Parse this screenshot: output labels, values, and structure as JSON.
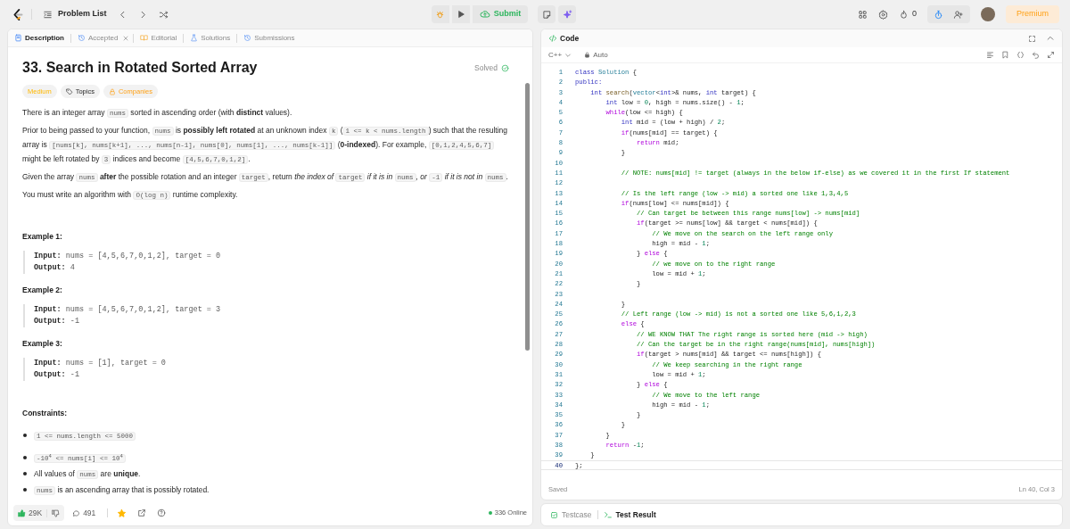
{
  "topbar": {
    "problem_list": "Problem List",
    "submit": "Submit",
    "streak": "0",
    "premium": "Premium"
  },
  "tabs": [
    {
      "kind": "description",
      "label": "Description",
      "selected": true,
      "closable": false
    },
    {
      "kind": "accepted",
      "label": "Accepted",
      "selected": false,
      "closable": true
    },
    {
      "kind": "editorial",
      "label": "Editorial",
      "selected": false,
      "closable": false
    },
    {
      "kind": "solutions",
      "label": "Solutions",
      "selected": false,
      "closable": false
    },
    {
      "kind": "submissions",
      "label": "Submissions",
      "selected": false,
      "closable": false
    }
  ],
  "problem": {
    "title": "33. Search in Rotated Sorted Array",
    "status": "Solved",
    "tags": [
      {
        "kind": "difficulty",
        "label": "Medium"
      },
      {
        "kind": "topics",
        "label": "Topics"
      },
      {
        "kind": "companies",
        "label": "Companies"
      }
    ],
    "paragraphs": [
      [
        {
          "kind": "text",
          "text": "There is an integer array "
        },
        {
          "kind": "code",
          "text": "nums"
        },
        {
          "kind": "text",
          "text": " sorted in ascending order (with **distinct** values)."
        }
      ],
      [
        {
          "kind": "text",
          "text": "Prior to being passed to your function, "
        },
        {
          "kind": "code",
          "text": "nums"
        },
        {
          "kind": "text",
          "text": " is **possibly left rotated** at an unknown index "
        },
        {
          "kind": "code",
          "text": "k"
        },
        {
          "kind": "text",
          "text": " ("
        },
        {
          "kind": "code",
          "text": "1 <= k < nums.length"
        },
        {
          "kind": "text",
          "text": ") such that the resulting array is "
        },
        {
          "kind": "code",
          "text": "[nums[k], nums[k+1], ..., nums[n-1], nums[0], nums[1], ..., nums[k-1]]"
        },
        {
          "kind": "text",
          "text": " (**0-indexed**). For example, "
        },
        {
          "kind": "code",
          "text": "[0,1,2,4,5,6,7]"
        },
        {
          "kind": "text",
          "text": " might be left rotated by "
        },
        {
          "kind": "code",
          "text": "3"
        },
        {
          "kind": "text",
          "text": " indices and become "
        },
        {
          "kind": "code",
          "text": "[4,5,6,7,0,1,2]"
        },
        {
          "kind": "text",
          "text": "."
        }
      ],
      [
        {
          "kind": "text",
          "text": "Given the array "
        },
        {
          "kind": "code",
          "text": "nums"
        },
        {
          "kind": "text",
          "text": " **after** the possible rotation and an integer "
        },
        {
          "kind": "code",
          "text": "target"
        },
        {
          "kind": "text",
          "text": ", return *the index of* "
        },
        {
          "kind": "code",
          "text": "target"
        },
        {
          "kind": "text",
          "text": " *if it is in* "
        },
        {
          "kind": "code",
          "text": "nums"
        },
        {
          "kind": "text",
          "text": "*, or* "
        },
        {
          "kind": "code",
          "text": "-1"
        },
        {
          "kind": "text",
          "text": " *if it is not in* "
        },
        {
          "kind": "code",
          "text": "nums"
        },
        {
          "kind": "text",
          "text": "."
        }
      ],
      [
        {
          "kind": "text",
          "text": "You must write an algorithm with "
        },
        {
          "kind": "code",
          "text": "O(log n)"
        },
        {
          "kind": "text",
          "text": " runtime complexity."
        }
      ]
    ],
    "examples": [
      {
        "title": "Example 1:",
        "lines": [
          {
            "label": "Input:",
            "value": "nums = [4,5,6,7,0,1,2], target = 0"
          },
          {
            "label": "Output:",
            "value": "4"
          }
        ]
      },
      {
        "title": "Example 2:",
        "lines": [
          {
            "label": "Input:",
            "value": "nums = [4,5,6,7,0,1,2], target = 3"
          },
          {
            "label": "Output:",
            "value": "-1"
          }
        ]
      },
      {
        "title": "Example 3:",
        "lines": [
          {
            "label": "Input:",
            "value": "nums = [1], target = 0"
          },
          {
            "label": "Output:",
            "value": "-1"
          }
        ]
      }
    ],
    "constraints_title": "Constraints:",
    "constraints": [
      [
        {
          "kind": "code",
          "text": "1 <= nums.length <= 5000"
        }
      ],
      [
        {
          "kind": "code",
          "text": "-10$^{4}$ <= nums[i] <= 10$^{4}$"
        }
      ],
      [
        {
          "kind": "text",
          "text": "All values of "
        },
        {
          "kind": "code",
          "text": "nums"
        },
        {
          "kind": "text",
          "text": " are **unique**."
        }
      ],
      [
        {
          "kind": "code",
          "text": "nums"
        },
        {
          "kind": "text",
          "text": " is an ascending array that is possibly rotated."
        }
      ]
    ]
  },
  "footer": {
    "likes": "29K",
    "comments": "491",
    "favorited": true,
    "online": "336 Online"
  },
  "editor": {
    "title": "Code",
    "language": "C++",
    "mode": "Auto",
    "status": "Saved",
    "cursor": "Ln 40, Col 3",
    "lines": [
      {
        "n": "1",
        "current": false,
        "tokens": [
          {
            "kind": "keyword",
            "text": "class "
          },
          {
            "kind": "type",
            "text": "Solution"
          },
          {
            "kind": "plain",
            "text": " {"
          }
        ]
      },
      {
        "n": "2",
        "current": false,
        "tokens": [
          {
            "kind": "keyword",
            "text": "public:"
          }
        ]
      },
      {
        "n": "3",
        "current": false,
        "tokens": [
          {
            "kind": "keyword",
            "text": "    int "
          },
          {
            "kind": "function",
            "text": "search"
          },
          {
            "kind": "plain",
            "text": "("
          },
          {
            "kind": "type",
            "text": "vector"
          },
          {
            "kind": "plain",
            "text": "<"
          },
          {
            "kind": "keyword",
            "text": "int"
          },
          {
            "kind": "plain",
            "text": ">& nums, "
          },
          {
            "kind": "keyword",
            "text": "int"
          },
          {
            "kind": "plain",
            "text": " target) {"
          }
        ]
      },
      {
        "n": "4",
        "current": false,
        "tokens": [
          {
            "kind": "keyword",
            "text": "        int"
          },
          {
            "kind": "plain",
            "text": " low = "
          },
          {
            "kind": "number",
            "text": "0"
          },
          {
            "kind": "plain",
            "text": ", high = nums.size() - "
          },
          {
            "kind": "number",
            "text": "1"
          },
          {
            "kind": "plain",
            "text": ";"
          }
        ]
      },
      {
        "n": "5",
        "current": false,
        "tokens": [
          {
            "kind": "control",
            "text": "        while"
          },
          {
            "kind": "plain",
            "text": "(low <= high) {"
          }
        ]
      },
      {
        "n": "6",
        "current": false,
        "tokens": [
          {
            "kind": "keyword",
            "text": "            int"
          },
          {
            "kind": "plain",
            "text": " mid = (low + high) / "
          },
          {
            "kind": "number",
            "text": "2"
          },
          {
            "kind": "plain",
            "text": ";"
          }
        ]
      },
      {
        "n": "7",
        "current": false,
        "tokens": [
          {
            "kind": "control",
            "text": "            if"
          },
          {
            "kind": "plain",
            "text": "(nums[mid] == target) {"
          }
        ]
      },
      {
        "n": "8",
        "current": false,
        "tokens": [
          {
            "kind": "control",
            "text": "                return"
          },
          {
            "kind": "plain",
            "text": " mid;"
          }
        ]
      },
      {
        "n": "9",
        "current": false,
        "tokens": [
          {
            "kind": "plain",
            "text": "            }"
          }
        ]
      },
      {
        "n": "10",
        "current": false
      },
      {
        "n": "11",
        "current": false,
        "tokens": [
          {
            "kind": "comment",
            "text": "            // NOTE: nums[mid] != target (always in the below if-else) as we covered it in the first If statement"
          }
        ]
      },
      {
        "n": "12",
        "current": false
      },
      {
        "n": "13",
        "current": false,
        "tokens": [
          {
            "kind": "comment",
            "text": "            // Is the left range (low -> mid) a sorted one like 1,3,4,5"
          }
        ]
      },
      {
        "n": "14",
        "current": false,
        "tokens": [
          {
            "kind": "control",
            "text": "            if"
          },
          {
            "kind": "plain",
            "text": "(nums[low] <= nums[mid]) {"
          }
        ]
      },
      {
        "n": "15",
        "current": false,
        "tokens": [
          {
            "kind": "comment",
            "text": "                // Can target be between this range nums[low] -> nums[mid]"
          }
        ]
      },
      {
        "n": "16",
        "current": false,
        "tokens": [
          {
            "kind": "control",
            "text": "                if"
          },
          {
            "kind": "plain",
            "text": "(target >= nums[low] && target < nums[mid]) {"
          }
        ]
      },
      {
        "n": "17",
        "current": false,
        "tokens": [
          {
            "kind": "comment",
            "text": "                    // We move on the search on the left range only"
          }
        ]
      },
      {
        "n": "18",
        "current": false,
        "tokens": [
          {
            "kind": "plain",
            "text": "                    high = mid - "
          },
          {
            "kind": "number",
            "text": "1"
          },
          {
            "kind": "plain",
            "text": ";"
          }
        ]
      },
      {
        "n": "19",
        "current": false,
        "tokens": [
          {
            "kind": "plain",
            "text": "                } "
          },
          {
            "kind": "control",
            "text": "else"
          },
          {
            "kind": "plain",
            "text": " {"
          }
        ]
      },
      {
        "n": "20",
        "current": false,
        "tokens": [
          {
            "kind": "comment",
            "text": "                    // we move on to the right range"
          }
        ]
      },
      {
        "n": "21",
        "current": false,
        "tokens": [
          {
            "kind": "plain",
            "text": "                    low = mid + "
          },
          {
            "kind": "number",
            "text": "1"
          },
          {
            "kind": "plain",
            "text": ";"
          }
        ]
      },
      {
        "n": "22",
        "current": false,
        "tokens": [
          {
            "kind": "plain",
            "text": "                }"
          }
        ]
      },
      {
        "n": "23",
        "current": false
      },
      {
        "n": "24",
        "current": false,
        "tokens": [
          {
            "kind": "plain",
            "text": "            }"
          }
        ]
      },
      {
        "n": "25",
        "current": false,
        "tokens": [
          {
            "kind": "comment",
            "text": "            // Left range (low -> mid) is not a sorted one like 5,6,1,2,3"
          }
        ]
      },
      {
        "n": "26",
        "current": false,
        "tokens": [
          {
            "kind": "control",
            "text": "            else"
          },
          {
            "kind": "plain",
            "text": " {"
          }
        ]
      },
      {
        "n": "27",
        "current": false,
        "tokens": [
          {
            "kind": "comment",
            "text": "                // WE KNOW THAT The right range is sorted here (mid -> high)"
          }
        ]
      },
      {
        "n": "28",
        "current": false,
        "tokens": [
          {
            "kind": "comment",
            "text": "                // Can the target be in the right range(nums[mid], nums[high])"
          }
        ]
      },
      {
        "n": "29",
        "current": false,
        "tokens": [
          {
            "kind": "control",
            "text": "                if"
          },
          {
            "kind": "plain",
            "text": "(target > nums[mid] && target <= nums[high]) {"
          }
        ]
      },
      {
        "n": "30",
        "current": false,
        "tokens": [
          {
            "kind": "comment",
            "text": "                    // We keep searching in the right range"
          }
        ]
      },
      {
        "n": "31",
        "current": false,
        "tokens": [
          {
            "kind": "plain",
            "text": "                    low = mid + "
          },
          {
            "kind": "number",
            "text": "1"
          },
          {
            "kind": "plain",
            "text": ";"
          }
        ]
      },
      {
        "n": "32",
        "current": false,
        "tokens": [
          {
            "kind": "plain",
            "text": "                } "
          },
          {
            "kind": "control",
            "text": "else"
          },
          {
            "kind": "plain",
            "text": " {"
          }
        ]
      },
      {
        "n": "33",
        "current": false,
        "tokens": [
          {
            "kind": "comment",
            "text": "                    // We move to the left range"
          }
        ]
      },
      {
        "n": "34",
        "current": false,
        "tokens": [
          {
            "kind": "plain",
            "text": "                    high = mid - "
          },
          {
            "kind": "number",
            "text": "1"
          },
          {
            "kind": "plain",
            "text": ";"
          }
        ]
      },
      {
        "n": "35",
        "current": false,
        "tokens": [
          {
            "kind": "plain",
            "text": "                }"
          }
        ]
      },
      {
        "n": "36",
        "current": false,
        "tokens": [
          {
            "kind": "plain",
            "text": "            }"
          }
        ]
      },
      {
        "n": "37",
        "current": false,
        "tokens": [
          {
            "kind": "plain",
            "text": "        }"
          }
        ]
      },
      {
        "n": "38",
        "current": false,
        "tokens": [
          {
            "kind": "control",
            "text": "        return"
          },
          {
            "kind": "plain",
            "text": " -"
          },
          {
            "kind": "number",
            "text": "1"
          },
          {
            "kind": "plain",
            "text": ";"
          }
        ]
      },
      {
        "n": "39",
        "current": false,
        "tokens": [
          {
            "kind": "plain",
            "text": "    }"
          }
        ]
      },
      {
        "n": "40",
        "current": true,
        "tokens": [
          {
            "kind": "plain",
            "text": "};"
          }
        ]
      }
    ]
  },
  "bottom_tabs": [
    {
      "kind": "testcase",
      "label": "Testcase",
      "selected": false
    },
    {
      "kind": "result",
      "label": "Test Result",
      "selected": true
    }
  ]
}
